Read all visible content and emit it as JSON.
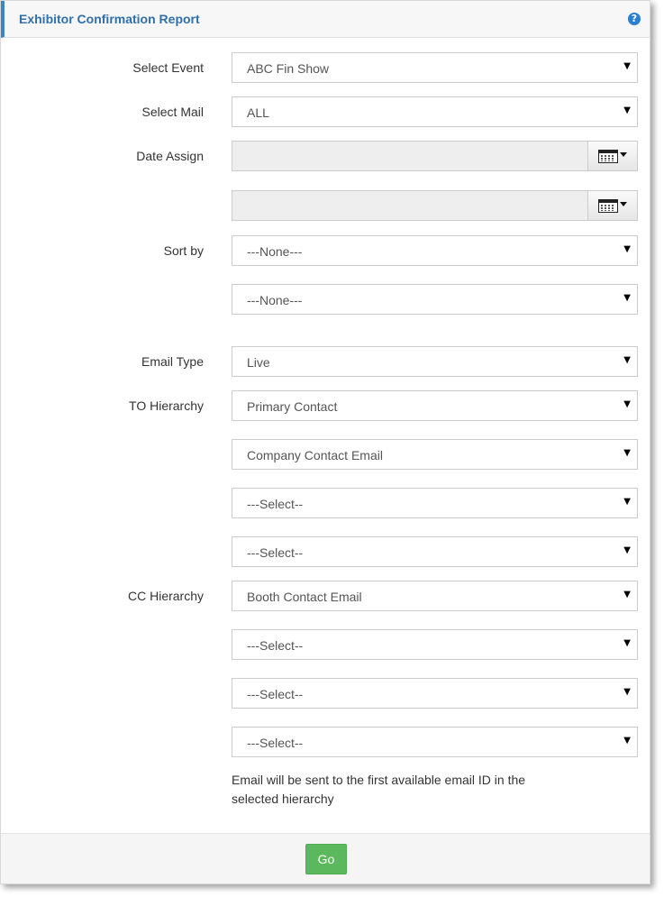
{
  "header": {
    "title": "Exhibitor Confirmation Report",
    "help_icon": "question-circle-icon",
    "help_glyph": "?"
  },
  "form": {
    "select_event": {
      "label": "Select Event",
      "value": "ABC Fin Show"
    },
    "select_mail": {
      "label": "Select Mail",
      "value": "ALL"
    },
    "date_assign": {
      "label": "Date Assign",
      "from": "",
      "to": "",
      "calendar_icon": "calendar-icon"
    },
    "sort_by": {
      "label": "Sort by",
      "values": [
        "---None---",
        "---None---"
      ]
    },
    "email_type": {
      "label": "Email Type",
      "value": "Live"
    },
    "to_hierarchy": {
      "label": "TO Hierarchy",
      "values": [
        "Primary Contact",
        "Company Contact Email",
        "---Select--",
        "---Select--"
      ]
    },
    "cc_hierarchy": {
      "label": "CC Hierarchy",
      "values": [
        "Booth Contact Email",
        "---Select--",
        "---Select--",
        "---Select--"
      ]
    },
    "note": "Email will be sent to the first available email ID in the selected hierarchy"
  },
  "footer": {
    "go_label": "Go"
  },
  "colors": {
    "accent": "#3a87c8",
    "title": "#2f6fab",
    "go": "#5cb85c"
  },
  "caret_glyph": "▼"
}
